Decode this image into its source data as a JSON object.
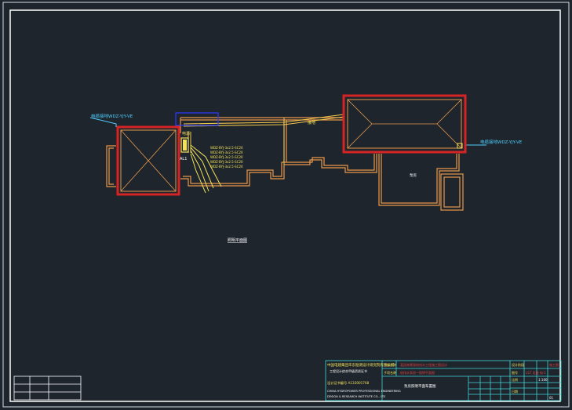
{
  "drawing": {
    "view_label": "照明平面图",
    "left_cable_label": "电缆接地WDZ-YJY-VE",
    "right_cable_label": "电缆接地WDZ-YJY-VE",
    "panel_label": "AL1",
    "breaker_label": "电源",
    "notes": [
      "WDZ-BYJ-3x2.5-SC20",
      "WDZ-BYJ-3x2.5-SC20",
      "WDZ-BYJ-3x2.5-SC20",
      "WDZ-BYJ-3x2.5-SC20",
      "WDZ-BYJ-3x2.5-SC20"
    ],
    "connector_label": "接地",
    "room_label": "泵房"
  },
  "title_block": {
    "company_cn": "中国电建集团华东勘测设计研究院有限公司",
    "company_line2": "工程设计综合甲级资质证书",
    "company_line3": "设计证书编号 A133001768",
    "company_en1": "CHINA HYDROPOWER PROFESSIONAL ENGINEERING",
    "company_en2": "DESIGN & RESEARCH INSTITUTE CO., LTD",
    "project_hdr": "工程名称",
    "project_name": "某园林景观给排水工程施工图设计",
    "subproject_hdr": "子项名称",
    "subproject_name": "给排水泵房—照明平面图",
    "drawing_name": "泵房照明平面布置图",
    "stage_hdr": "设计阶段",
    "stage_val": "施工图",
    "number_hdr": "图号",
    "number_val": "LS7 设施 电-1",
    "scale_hdr": "比例",
    "scale_val": "1:100",
    "date_hdr": "日期",
    "sheet_val": "01"
  }
}
